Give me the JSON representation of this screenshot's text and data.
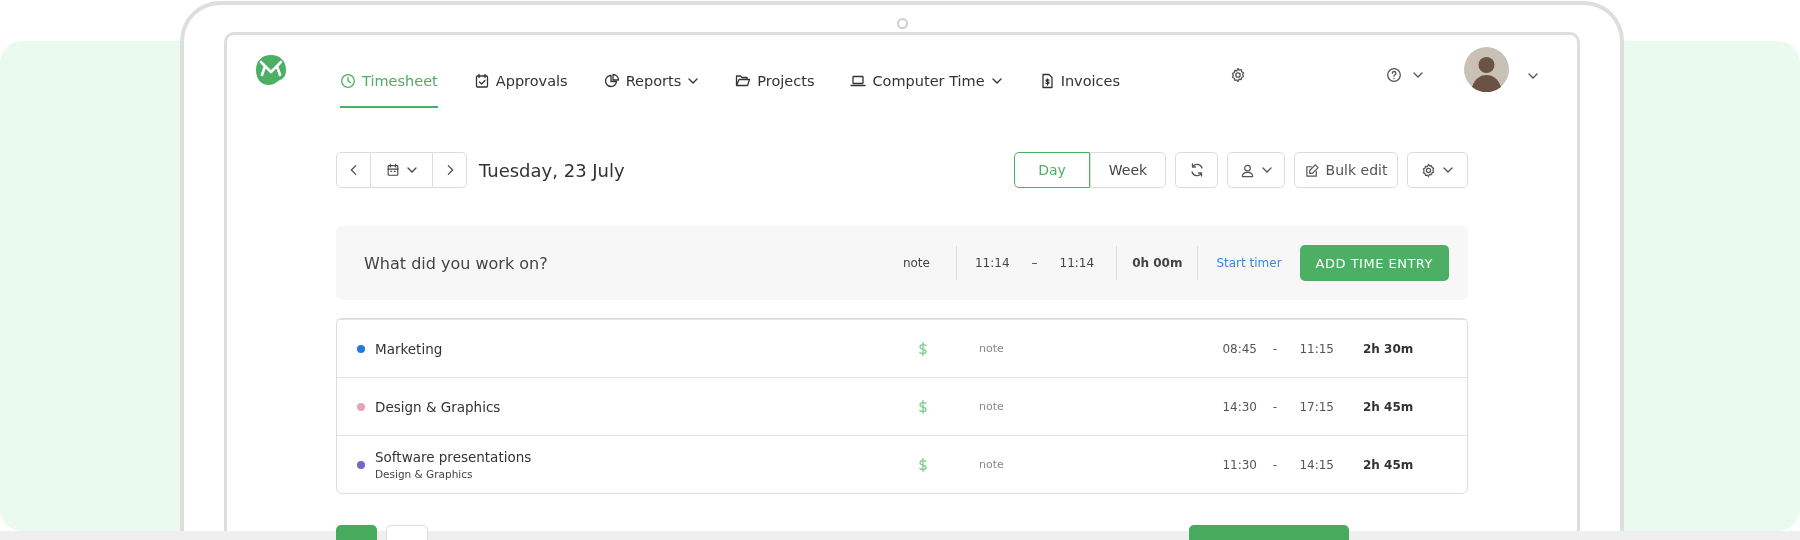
{
  "nav": {
    "items": [
      {
        "label": "Timesheet",
        "selected": true,
        "has_menu": false
      },
      {
        "label": "Approvals",
        "selected": false,
        "has_menu": false
      },
      {
        "label": "Reports",
        "selected": false,
        "has_menu": true
      },
      {
        "label": "Projects",
        "selected": false,
        "has_menu": false
      },
      {
        "label": "Computer Time",
        "selected": false,
        "has_menu": true
      },
      {
        "label": "Invoices",
        "selected": false,
        "has_menu": false
      }
    ]
  },
  "toolbar": {
    "date": "Tuesday, 23 July",
    "views": [
      {
        "label": "Day",
        "selected": true
      },
      {
        "label": "Week",
        "selected": false
      }
    ],
    "bulk_edit": "Bulk edit"
  },
  "entry": {
    "placeholder": "What did you work on?",
    "note": "note",
    "start": "11:14",
    "separator": "–",
    "end": "11:14",
    "duration": "0h 00m",
    "start_timer": "Start timer",
    "add": "ADD TIME ENTRY"
  },
  "entries": [
    {
      "project": "Marketing",
      "color": "#1e7be0",
      "billable": true,
      "note": "note",
      "start": "08:45",
      "separator": "-",
      "end": "11:15",
      "duration": "2h 30m"
    },
    {
      "project": "Design & Graphics",
      "color": "#eaa3b3",
      "billable": true,
      "note": "note",
      "start": "14:30",
      "separator": "-",
      "end": "17:15",
      "duration": "2h 45m"
    },
    {
      "project": "Software presentations",
      "client": "Design & Graphics",
      "color": "#7b63c6",
      "billable": true,
      "note": "note",
      "start": "11:30",
      "separator": "-",
      "end": "14:15",
      "duration": "2h 45m"
    }
  ]
}
